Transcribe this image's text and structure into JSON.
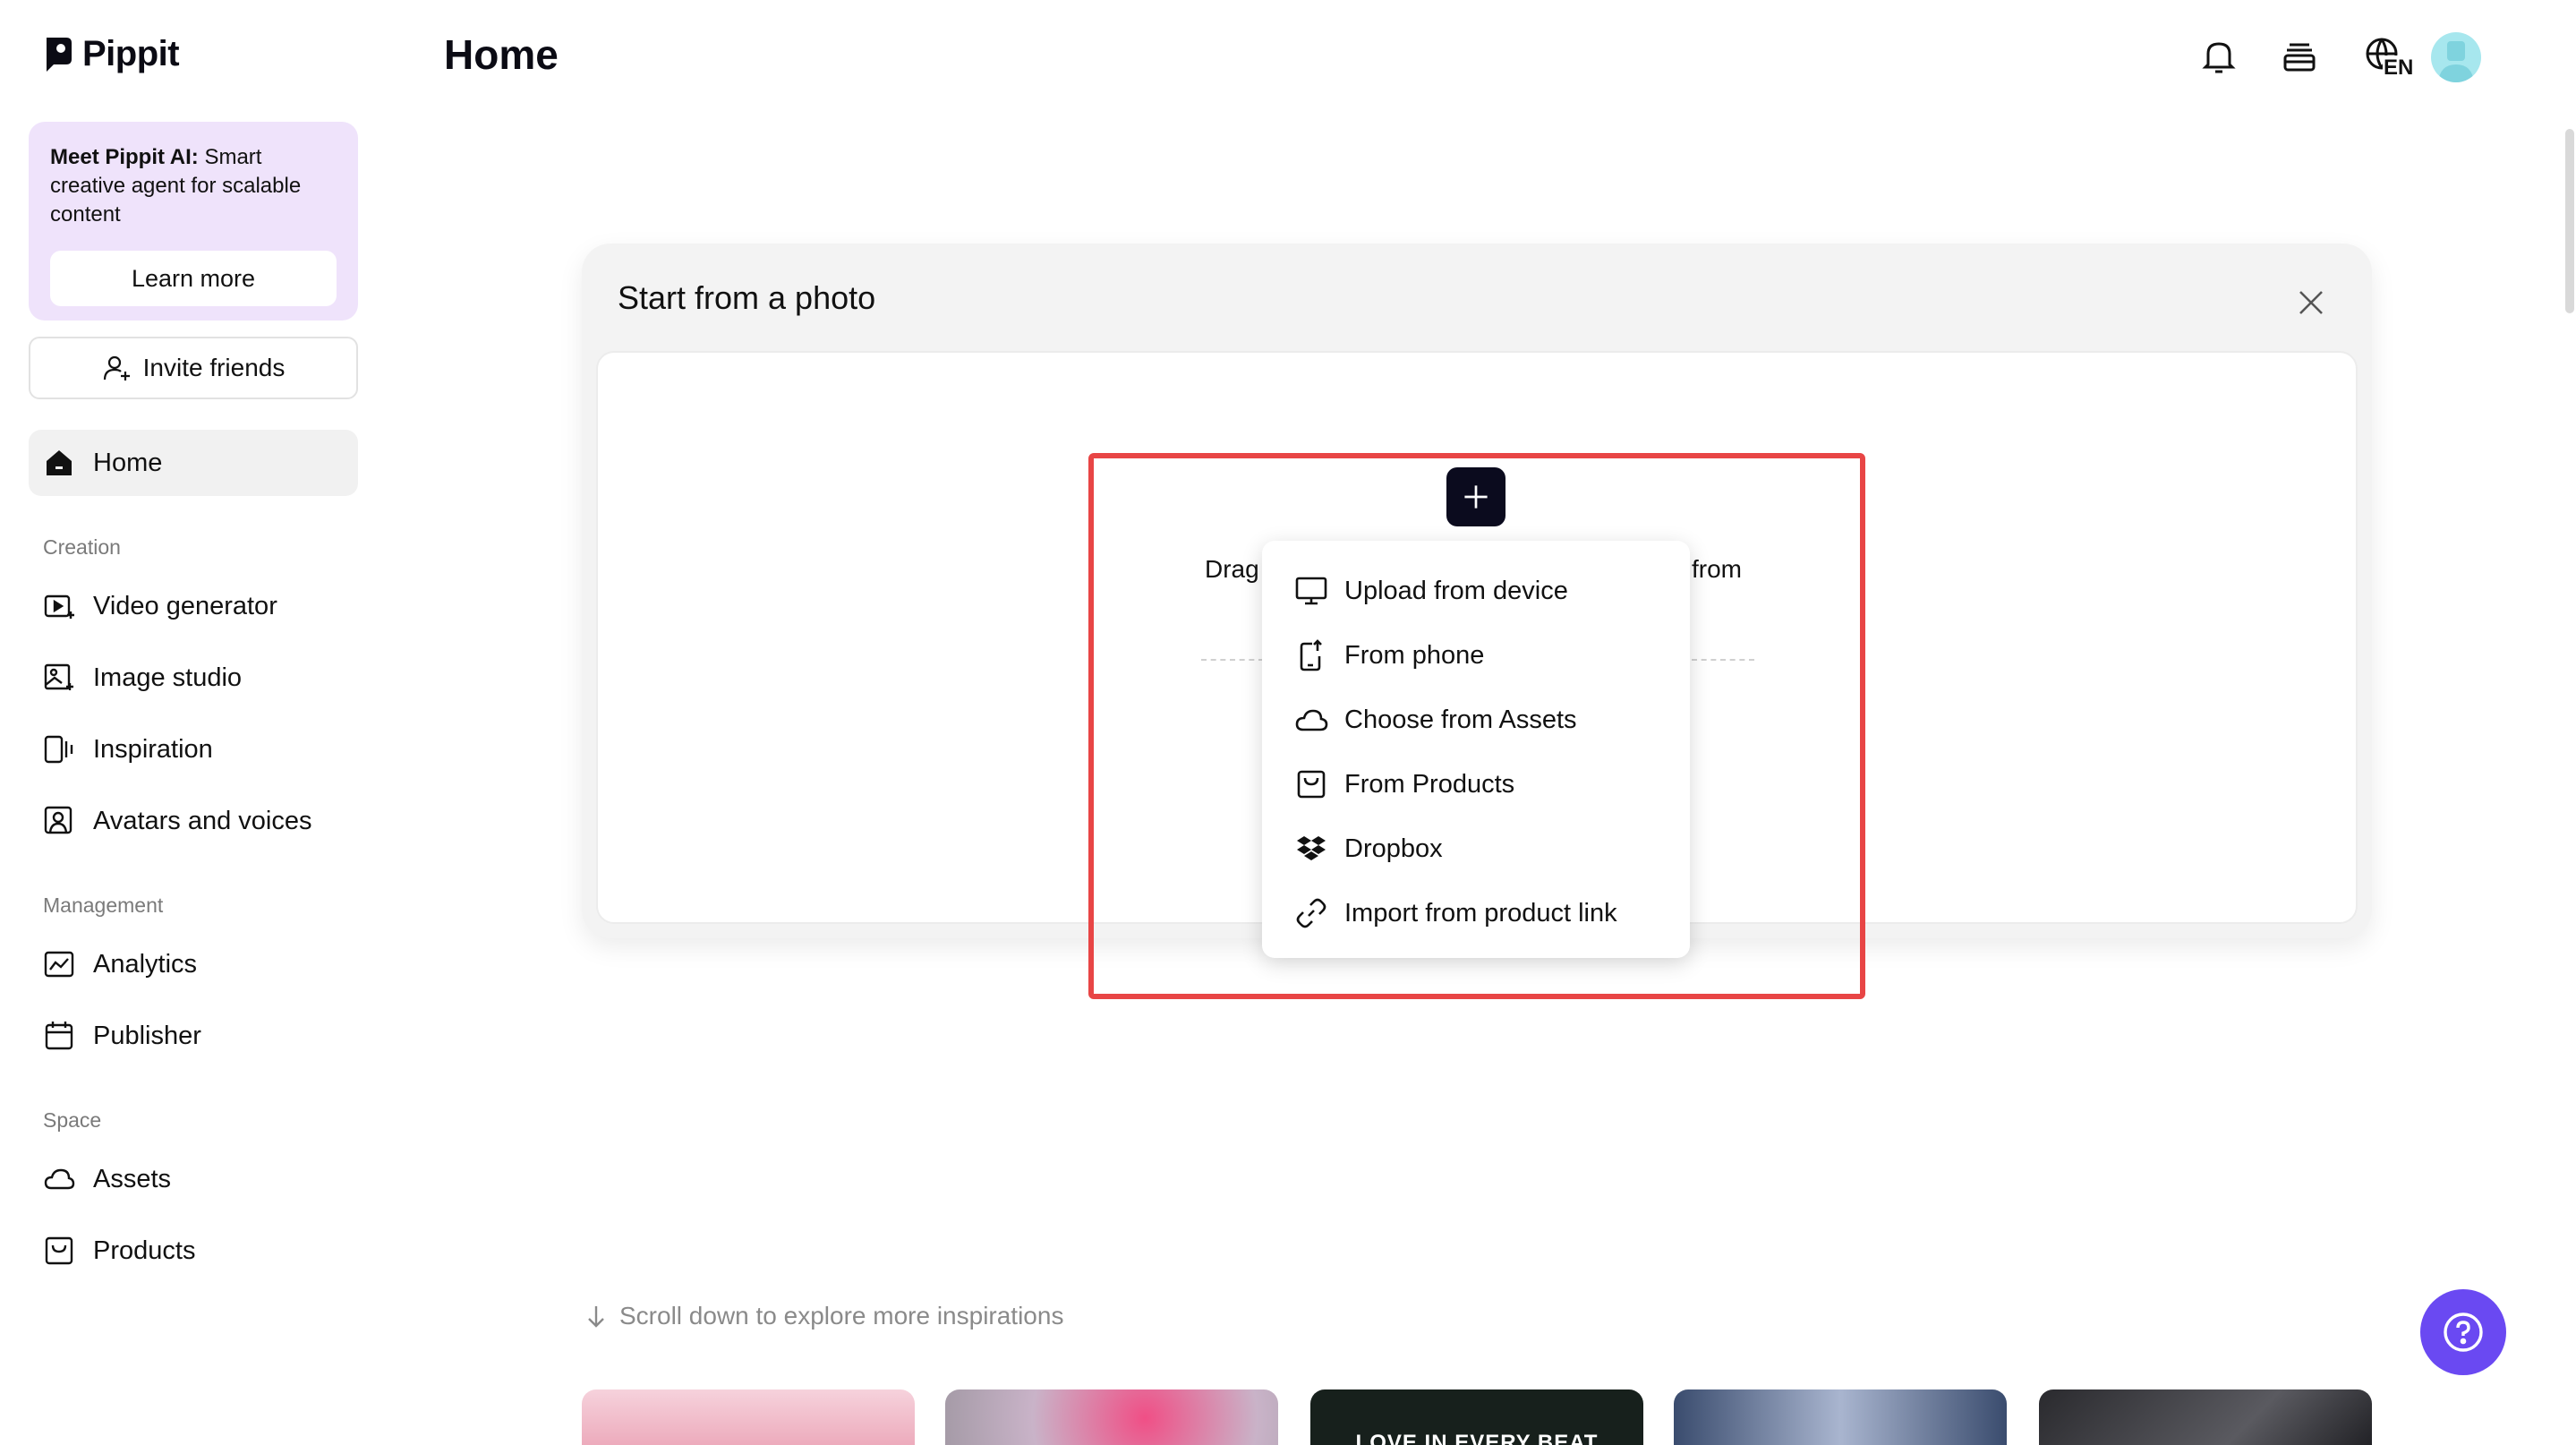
{
  "brand": {
    "name": "Pippit"
  },
  "promo": {
    "bold": "Meet Pippit AI:",
    "text": " Smart creative agent for scalable content",
    "button": "Learn more"
  },
  "invite": {
    "label": "Invite friends"
  },
  "nav": {
    "home": "Home",
    "sections": {
      "creation": "Creation",
      "management": "Management",
      "space": "Space"
    },
    "items": {
      "video_generator": "Video generator",
      "image_studio": "Image studio",
      "inspiration": "Inspiration",
      "avatars_voices": "Avatars and voices",
      "analytics": "Analytics",
      "publisher": "Publisher",
      "assets": "Assets",
      "products": "Products"
    }
  },
  "header": {
    "title": "Home",
    "language": "EN",
    "icons": [
      "bell-icon",
      "stack-icon",
      "globe-icon",
      "avatar"
    ]
  },
  "modal": {
    "title": "Start from a photo",
    "drag_left": "Drag",
    "drag_right": "from"
  },
  "menu": {
    "items": [
      {
        "icon": "monitor-icon",
        "label": "Upload from device"
      },
      {
        "icon": "phone-icon",
        "label": "From phone"
      },
      {
        "icon": "cloud-icon",
        "label": "Choose from Assets"
      },
      {
        "icon": "product-box-icon",
        "label": "From Products"
      },
      {
        "icon": "dropbox-icon",
        "label": "Dropbox"
      },
      {
        "icon": "link-icon",
        "label": "Import from product link"
      }
    ]
  },
  "bottom": {
    "scroll_hint": "Scroll down to explore more inspirations",
    "thumb3_text": "LOVE IN EVERY BEAT"
  },
  "colors": {
    "promo_bg": "#efe3fb",
    "highlight": "#e84545",
    "help": "#6a49f2",
    "plus_btn": "#0b0b1e"
  }
}
